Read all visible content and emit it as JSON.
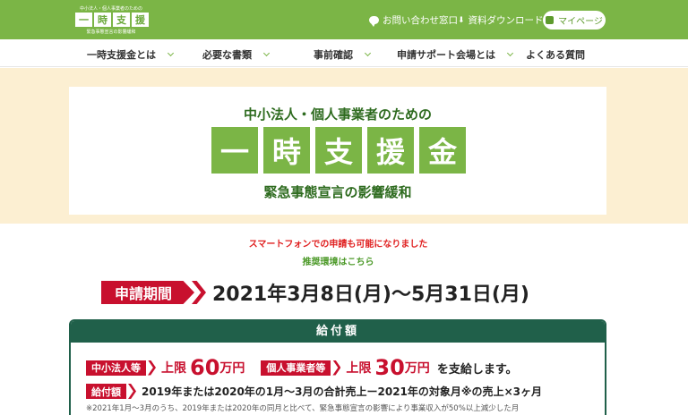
{
  "header": {
    "logo": {
      "top_caption": "中小法人・個人事業者のための",
      "chars": [
        "一",
        "時",
        "支",
        "援",
        "金"
      ],
      "bottom_caption": "緊急事態宣言の影響緩和"
    },
    "links": {
      "contact": "お問い合わせ窓口",
      "download": "資料ダウンロード"
    },
    "mypage_label": "マイページ"
  },
  "nav": {
    "items": [
      {
        "label": "一時支援金とは"
      },
      {
        "label": "必要な書類"
      },
      {
        "label": "事前確認"
      },
      {
        "label": "申請サポート会場とは"
      },
      {
        "label": "よくある質問"
      }
    ]
  },
  "hero": {
    "lead": "中小法人・個人事業者のための",
    "title_chars": [
      "一",
      "時",
      "支",
      "援",
      "金"
    ],
    "subtitle": "緊急事態宣言の影響緩和"
  },
  "notices": {
    "smartphone": "スマートフォンでの申請も可能になりました",
    "env_link": "推奨環境はこちら"
  },
  "period": {
    "tag": "申請期間",
    "text": "2021年3月8日(月)～5月31日(月)"
  },
  "amount": {
    "heading": "給付額",
    "corp_tag": "中小法人等",
    "corp_limit_label": "上限",
    "corp_limit_value": "60",
    "corp_limit_unit": "万円",
    "indiv_tag": "個人事業者等",
    "indiv_limit_label": "上限",
    "indiv_limit_value": "30",
    "indiv_limit_unit": "万円",
    "tail": "を支給します。",
    "formula_tag": "給付額",
    "formula": "2019年または2020年の1月～3月の合計売上ー2021年の対象月※の売上×3ヶ月",
    "footnote": "※2021年1月～3月のうち、2019年または2020年の同月と比べて、緊急事態宣言の影響により事業収入が50%以上減少した月"
  }
}
